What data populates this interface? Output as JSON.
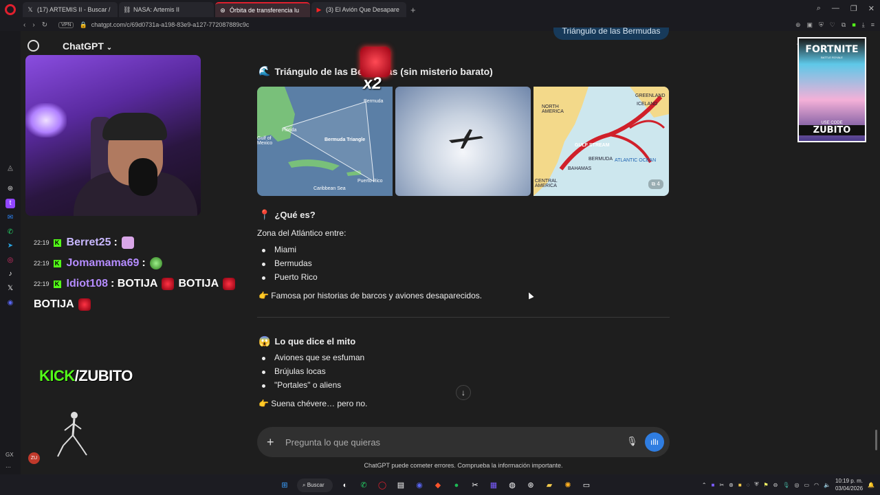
{
  "browser": {
    "tabs": [
      {
        "icon": "x-icon",
        "label": "(17) ARTEMIS II - Buscar /"
      },
      {
        "icon": "link-icon",
        "label": "NASA: Artemis II"
      },
      {
        "icon": "chatgpt-icon",
        "label": "Órbita de transferencia lu",
        "active": true
      },
      {
        "icon": "youtube-icon",
        "label": "(3) El Avión Que Desapare"
      }
    ],
    "url": "chatgpt.com/c/69d0731a-a198-83e9-a127-772087889c9c",
    "vpn_label": "VPN"
  },
  "chatgpt": {
    "model_label": "ChatGPT",
    "user_bubble": "Triángulo de las Bermudas",
    "section1_title": "Triángulo de las Bermudas (sin misterio barato)",
    "section1_emoji": "🌊",
    "gallery_count": "4",
    "map1_labels": {
      "bermuda": "Bermuda",
      "florida": "Florida",
      "triangle": "Bermuda Triangle",
      "gulf": "Gulf of Mexico",
      "caribbean": "Caribbean Sea",
      "pr": "Puerto Rico"
    },
    "map3_labels": {
      "na": "NORTH AMERICA",
      "gs": "GULF STREAM",
      "ao": "ATLANTIC OCEAN",
      "ca": "CENTRAL AMERICA",
      "bermuda": "BERMUDA",
      "bahamas": "BAHAMAS",
      "greenland": "GREENLAND",
      "iceland": "ICELAND"
    },
    "q_title": "¿Qué es?",
    "q_emoji": "📍",
    "zone_text": "Zona del Atlántico entre:",
    "zone_items": [
      "Miami",
      "Bermudas",
      "Puerto Rico"
    ],
    "famous_text": "👉 Famosa por historias de barcos y aviones desaparecidos.",
    "myth_title": "Lo que dice el mito",
    "myth_emoji": "😱",
    "myth_items": [
      "Aviones que se esfuman",
      "Brújulas locas",
      "\"Portales\" o aliens"
    ],
    "myth_conclusion": "👉 Suena chévere… pero no.",
    "composer_placeholder": "Pregunta lo que quieras",
    "disclaimer": "ChatGPT puede cometer errores. Comprueba la información importante."
  },
  "stream": {
    "chat": [
      {
        "time": "22:19",
        "user": "Berret25",
        "msg": ":",
        "emotes": [
          "pink"
        ]
      },
      {
        "time": "22:19",
        "user": "Jomamama69",
        "msg": ":",
        "emotes": [
          "frog"
        ]
      },
      {
        "time": "22:19",
        "user": "Idiot108",
        "msg": ": BOTIJA",
        "extra1": "BOTIJA",
        "extra2": "BOTIJA"
      }
    ],
    "kick_brand": "KICK",
    "kick_slash": "/ZUBITO",
    "x2_label": "x2",
    "fortnite_title": "FORTNITE",
    "fortnite_sub": "BATTLE ROYALE",
    "fortnite_use_code": "USE CODE",
    "fortnite_code": "ZUBITO",
    "avatar_initials": "ZU",
    "sidebar_gx": "GX"
  },
  "taskbar": {
    "search_label": "Buscar",
    "time": "10:19 p. m.",
    "date": "03/04/2026"
  },
  "colors": {
    "accent": "#e0202e",
    "kick": "#53fc18",
    "voice": "#2f7de1"
  }
}
